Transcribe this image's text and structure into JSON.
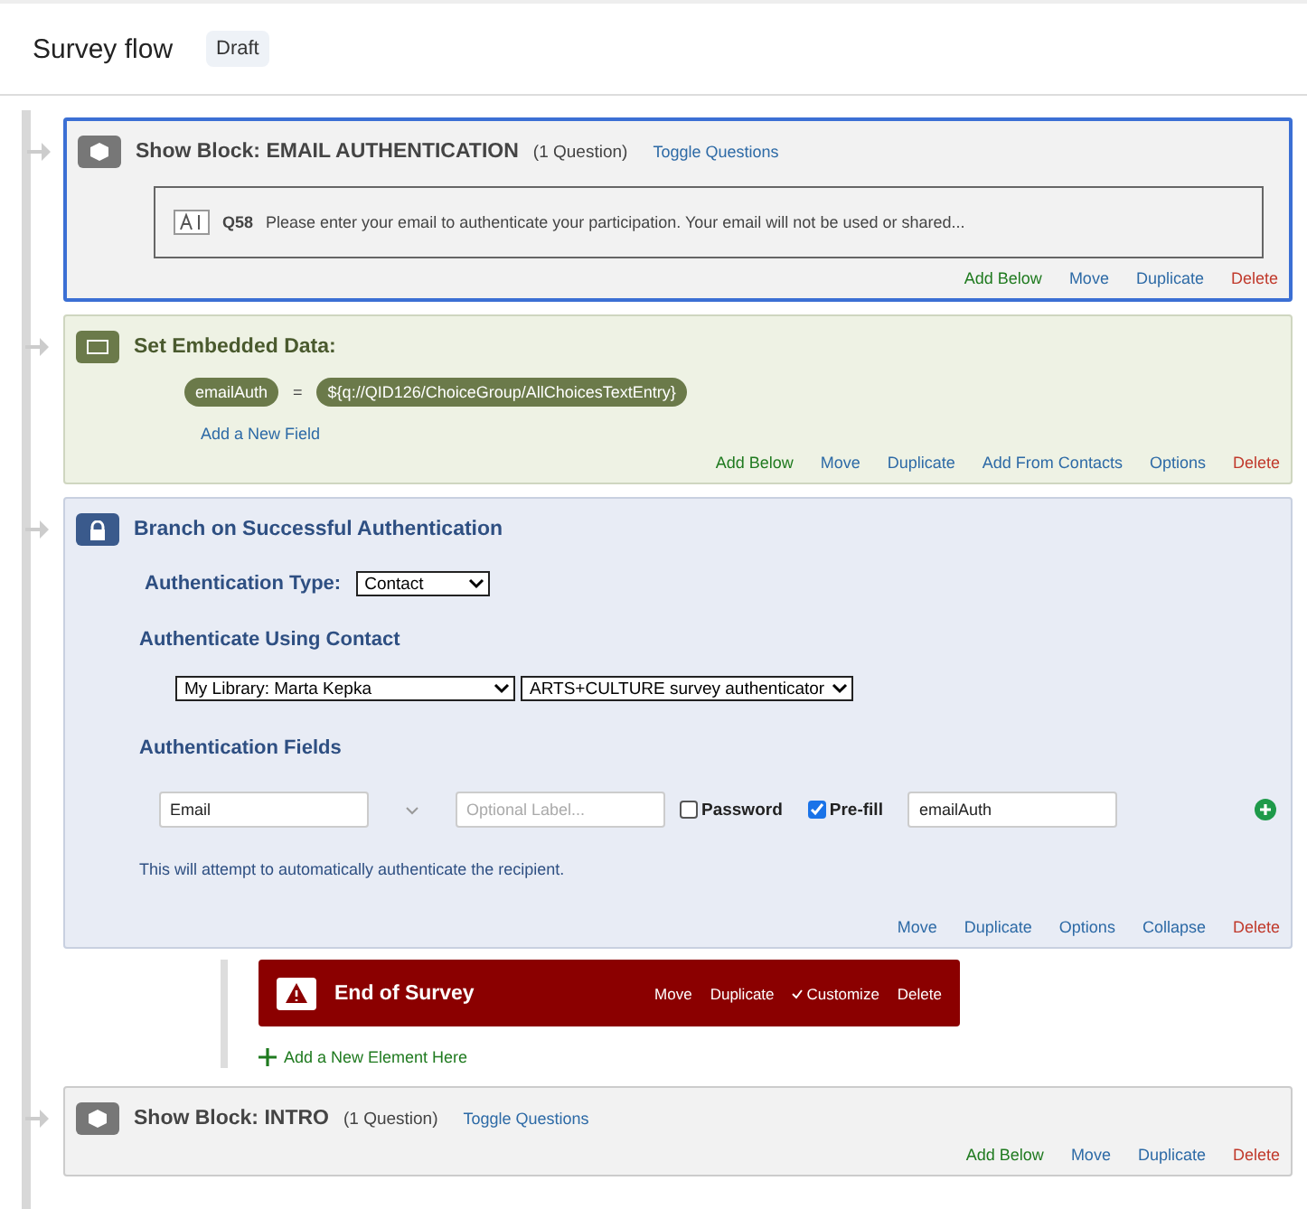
{
  "header": {
    "title": "Survey flow",
    "badge": "Draft"
  },
  "blocks": [
    {
      "kind": "block",
      "selected": true,
      "title": "Show Block: EMAIL AUTHENTICATION",
      "count": "(1 Question)",
      "toggle": "Toggle Questions",
      "question": {
        "id": "Q58",
        "text": "Please enter your email to authenticate your participation. Your email will not be used or shared..."
      },
      "actions": [
        {
          "label": "Add Below",
          "kind": "add"
        },
        {
          "label": "Move",
          "kind": "normal"
        },
        {
          "label": "Duplicate",
          "kind": "normal"
        },
        {
          "label": "Delete",
          "kind": "delete"
        }
      ]
    },
    {
      "kind": "embedded",
      "selected": false,
      "title": "Set Embedded Data:",
      "field": {
        "name": "emailAuth",
        "op": "=",
        "value": "${q://QID126/ChoiceGroup/AllChoicesTextEntry}"
      },
      "add_field": "Add a New Field",
      "actions": [
        {
          "label": "Add Below",
          "kind": "add"
        },
        {
          "label": "Move",
          "kind": "normal"
        },
        {
          "label": "Duplicate",
          "kind": "normal"
        },
        {
          "label": "Add From Contacts",
          "kind": "normal"
        },
        {
          "label": "Options",
          "kind": "normal"
        },
        {
          "label": "Delete",
          "kind": "delete"
        }
      ]
    },
    {
      "kind": "auth",
      "selected": false,
      "title": "Branch on Successful Authentication",
      "type_label": "Authentication Type:",
      "type_value": "Contact",
      "using_label": "Authenticate Using Contact",
      "library": "My Library: Marta Kepka",
      "list": "ARTS+CULTURE survey authenticator",
      "fields_label": "Authentication Fields",
      "field": "Email",
      "label_placeholder": "Optional Label...",
      "password": {
        "label": "Password",
        "checked": false
      },
      "prefill": {
        "label": "Pre-fill",
        "checked": true
      },
      "prefill_value": "emailAuth",
      "note": "This will attempt to automatically authenticate the recipient.",
      "actions": [
        {
          "label": "Move",
          "kind": "normal"
        },
        {
          "label": "Duplicate",
          "kind": "normal"
        },
        {
          "label": "Options",
          "kind": "normal"
        },
        {
          "label": "Collapse",
          "kind": "normal"
        },
        {
          "label": "Delete",
          "kind": "delete"
        }
      ],
      "children": [
        {
          "title": "End of Survey",
          "actions": [
            "Move",
            "Duplicate",
            "Customize",
            "Delete"
          ],
          "customized": true
        }
      ],
      "add_element": "Add a New Element Here"
    },
    {
      "kind": "block",
      "selected": false,
      "title": "Show Block: INTRO",
      "count": "(1 Question)",
      "toggle": "Toggle Questions",
      "actions": [
        {
          "label": "Add Below",
          "kind": "add"
        },
        {
          "label": "Move",
          "kind": "normal"
        },
        {
          "label": "Duplicate",
          "kind": "normal"
        },
        {
          "label": "Delete",
          "kind": "delete"
        }
      ]
    }
  ]
}
